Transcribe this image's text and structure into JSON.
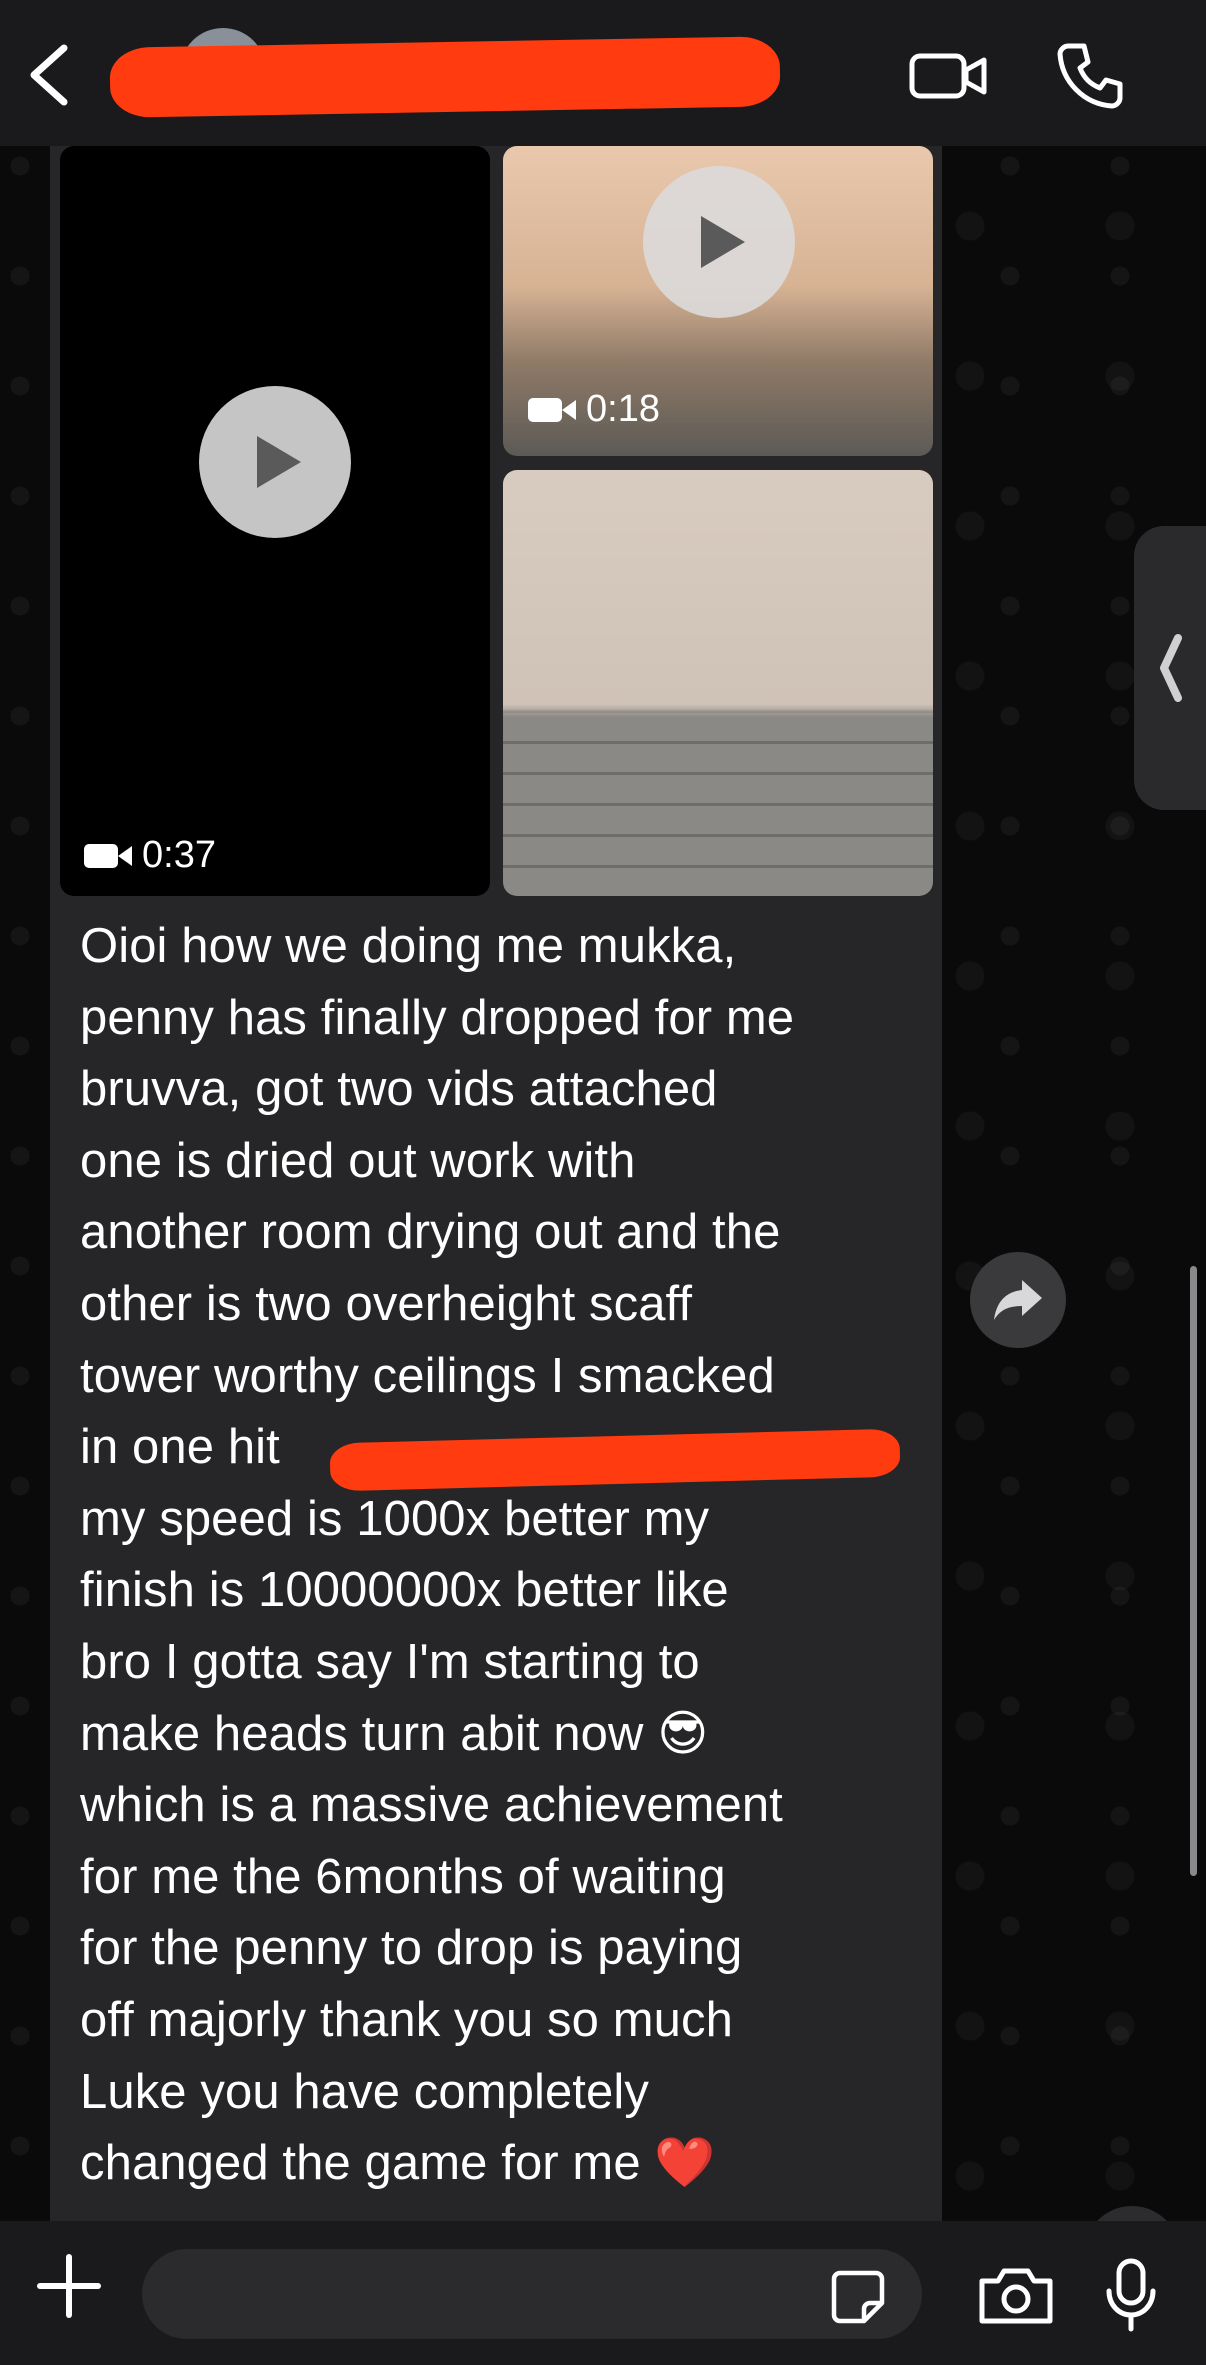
{
  "header": {
    "title": ""
  },
  "media": {
    "video_left_duration": "0:37",
    "video_right_duration": "0:18"
  },
  "message": {
    "lines": [
      "Oioi how we doing me mukka,",
      "penny has finally dropped for me",
      "bruvva, got two vids attached",
      "one is dried out work with",
      "another room drying out and the",
      "other is two overheight scaff",
      "tower worthy ceilings I smacked",
      "in one hit",
      "my speed is 1000x better my",
      "finish is 10000000x better like",
      "bro I gotta say I'm starting to",
      "make heads turn abit now 😎",
      "which is a massive achievement",
      "for me the 6months of waiting",
      "for the penny to drop is paying",
      "off majorly thank you so much",
      "Luke you have completely",
      "changed the game for me ❤️"
    ]
  },
  "input": {
    "placeholder": ""
  },
  "icons": {
    "back": "chevron-left-icon",
    "video_call": "video-camera-icon",
    "voice_call": "phone-icon",
    "forward": "forward-arrow-icon",
    "scroll_down": "chevron-down-icon",
    "plus": "plus-icon",
    "sticker": "sticker-icon",
    "camera": "camera-icon",
    "mic": "microphone-icon"
  },
  "colors": {
    "header_bg": "#1a1a1c",
    "bubble_bg": "#262628",
    "redaction": "#ff3b0f"
  }
}
